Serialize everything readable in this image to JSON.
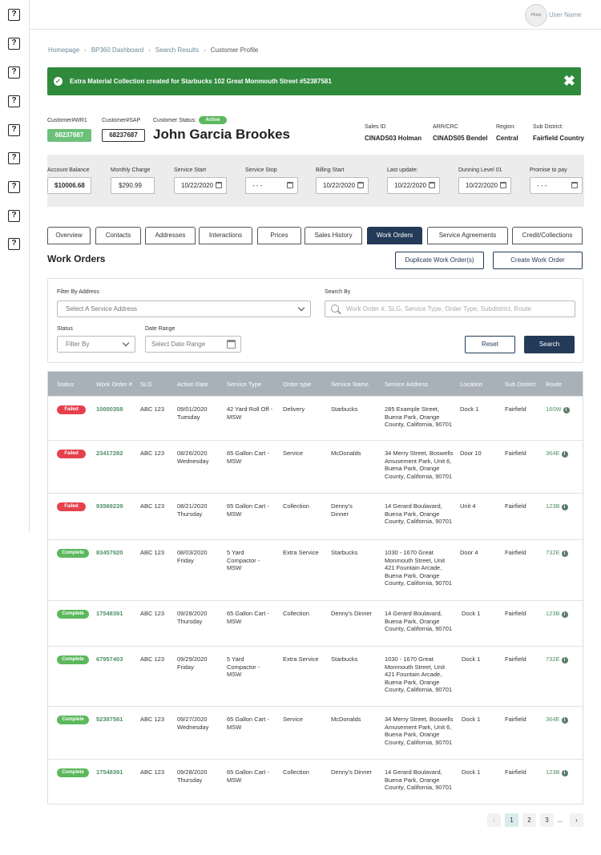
{
  "topbar": {
    "avatar_label": "Photo",
    "username": "User Name"
  },
  "sidebar": {
    "icon_glyph": "?",
    "icons": [
      "help-icon",
      "help-icon",
      "help-icon",
      "help-icon",
      "help-icon",
      "help-icon",
      "help-icon",
      "help-icon",
      "help-icon"
    ]
  },
  "breadcrumb": [
    "Homepage",
    "BP360 Dashboard",
    "Search Results",
    "Customer Profile"
  ],
  "breadcrumb_sep": "›",
  "alert": {
    "message": "Extra Material Collection created for Starbucks 102 Great Monmouth Street #52387581",
    "close": "✖",
    "check": "✓"
  },
  "customer": {
    "wr1_label": "Customer#WR1",
    "wr1_value": "68237687",
    "sap_label": "Customer#SAP",
    "sap_value": "68237687",
    "status_label": "Customer Status:",
    "status_value": "Active",
    "name": "John Garcia Brookes",
    "sales_id_label": "Sales ID",
    "sales_id_value": "CINADS03 Holman",
    "arr_label": "ARR/CRC",
    "arr_value": "CINADS05 Bendel",
    "region_label": "Region:",
    "region_value": "Central",
    "subdistrict_label": "Sub District:",
    "subdistrict_value": "Fairfield Country"
  },
  "account": {
    "balance_label": "Account Balance",
    "balance_value": "$10006.68",
    "monthly_label": "Monthly Charge",
    "monthly_value": "$290.99",
    "service_start_label": "Service Start",
    "service_start_value": "10/22/2020",
    "service_stop_label": "Service Stop",
    "service_stop_value": "- - -",
    "billing_start_label": "Billing Start",
    "billing_start_value": "10/22/2020",
    "last_update_label": "Last update:",
    "last_update_value": "10/22/2020",
    "dunning_label": "Dunning Level 01",
    "dunning_value": "10/22/2020",
    "promise_label": "Promise to pay",
    "promise_value": "- - -"
  },
  "tabs": [
    "Overview",
    "Contacts",
    "Addresses",
    "Interactions",
    "Prices",
    "Sales History",
    "Work Orders",
    "Service Agreements",
    "Credit/Collections"
  ],
  "active_tab": "Work Orders",
  "work_orders": {
    "title": "Work Orders",
    "duplicate_button": "Duplicate Work Order(s)",
    "create_button": "Create Work Order",
    "filter_address_label": "Filter By Address",
    "filter_address_placeholder": "Select A Service Address",
    "search_by_label": "Search By",
    "search_placeholder": "Work Order #, SLG, Service Type, Order Type, Subdistrict, Route",
    "status_label": "Status",
    "status_placeholder": "Filter By",
    "date_range_label": "Date Range",
    "date_range_placeholder": "Select Date Range",
    "reset_button": "Reset",
    "search_button": "Search"
  },
  "table": {
    "headers": [
      "Status",
      "Work Order #",
      "SLG",
      "Action Date",
      "Service Type",
      "Order type",
      "Service Name",
      "Service Address",
      "Location",
      "Sub District",
      "Route"
    ],
    "rows": [
      {
        "status": "Failed",
        "wo": "10000358",
        "slg": "ABC 123",
        "date": "09/01/2020",
        "day": "Tuesday",
        "stype": "42 Yard Roll Off - MSW",
        "otype": "Delivery",
        "sname": "Starbucks",
        "addr": "285 Example Street, Buena Park, Orange County, California, 90701",
        "loc": "Dock 1",
        "sub": "Fairfield",
        "route": "160W"
      },
      {
        "status": "Failed",
        "wo": "23417282",
        "slg": "ABC 123",
        "date": "08/26/2020",
        "day": "Wednesday",
        "stype": "65 Gallon Cart - MSW",
        "otype": "Service",
        "sname": "McDonalds",
        "addr": "34 Merry Street, Boswells Amusement Park, Unit 6, Buena Park, Orange County, California, 90701",
        "loc": "Door 10",
        "sub": "Fairfield",
        "route": "364E"
      },
      {
        "status": "Failed",
        "wo": "93569239",
        "slg": "ABC 123",
        "date": "08/21/2020",
        "day": "Thursday",
        "stype": "65 Gallon Cart - MSW",
        "otype": "Collection",
        "sname": "Denny's Dinner",
        "addr": "14 Gerard Boulavard, Buena Park, Orange County, California, 90701",
        "loc": "Unit 4",
        "sub": "Fairfield",
        "route": "123B"
      },
      {
        "status": "Complete",
        "wo": "83457920",
        "slg": "ABC 123",
        "date": "08/03/2020",
        "day": "Friday",
        "stype": "5 Yard Compactor - MSW",
        "otype": "Extra Service",
        "sname": "Starbucks",
        "addr": "1030 - 1670 Great Monmouth Street, Unit 421 Fountain Arcade, Buena Park, Orange County, California, 90701",
        "loc": "Door 4",
        "sub": "Fairfield",
        "route": "732E"
      },
      {
        "status": "Complete",
        "wo": "17548391",
        "slg": "ABC 123",
        "date": "09/28/2020",
        "day": "Thursday",
        "stype": "65 Gallon Cart - MSW",
        "otype": "Collection",
        "sname": "Denny's Dinner",
        "addr": "14 Gerard Boulavard, Buena Park, Orange County, California, 90701",
        "loc": "Dock 1",
        "sub": "Fairfield",
        "route": "123B"
      },
      {
        "status": "Complete",
        "wo": "67957403",
        "slg": "ABC 123",
        "date": "09/29/2020",
        "day": "Friday",
        "stype": "5 Yard Compactor - MSW",
        "otype": "Extra Service",
        "sname": "Starbucks",
        "addr": "1030 - 1670 Great Monmouth Street, Unit 421 Fountain Arcade, Buena Park, Orange County, California, 90701",
        "loc": "Dock 1",
        "sub": "Fairfield",
        "route": "732E"
      },
      {
        "status": "Complete",
        "wo": "52387581",
        "slg": "ABC 123",
        "date": "09/27/2020",
        "day": "Wednesday",
        "stype": "65 Gallon Cart - MSW",
        "otype": "Service",
        "sname": "McDonalds",
        "addr": "34 Merry Street, Boswells Amusement Park, Unit 6, Buena Park, Orange County, California, 90701",
        "loc": "Dock 1",
        "sub": "Fairfield",
        "route": "364E"
      },
      {
        "status": "Complete",
        "wo": "17548391",
        "slg": "ABC 123",
        "date": "09/28/2020",
        "day": "Thursday",
        "stype": "65 Gallon Cart - MSW",
        "otype": "Collection",
        "sname": "Denny's Dinner",
        "addr": "14 Gerard Boulavard, Buena Park, Orange County, California, 90701",
        "loc": "Dock 1",
        "sub": "Fairfield",
        "route": "123B"
      }
    ]
  },
  "pagination": {
    "prev": "‹",
    "pages": [
      "1",
      "2",
      "3"
    ],
    "ellipsis": "...",
    "next": "›",
    "current": "1"
  },
  "colors": {
    "accent": "#233a58",
    "success": "#2f8a3c",
    "failed": "#e5414d",
    "complete": "#5cb85c",
    "link": "#4e8f66"
  }
}
